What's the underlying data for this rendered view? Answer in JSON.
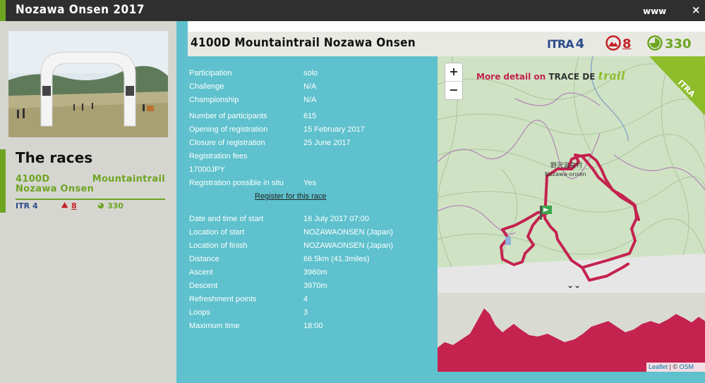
{
  "window": {
    "title": "Nozawa Onsen 2017",
    "www_label": "www",
    "close_label": "×"
  },
  "sidebar": {
    "races_title": "The races",
    "race_link": "4100D Mountaintrail Nozawa Onsen",
    "itra_value": "4",
    "mountain_value": "8",
    "points_value": "330"
  },
  "race": {
    "name": "4100D Mountaintrail Nozawa Onsen",
    "itra_label": "ITRA",
    "itra_value": "4",
    "mountain_value": "8",
    "points_value": "330"
  },
  "details_group1": [
    {
      "label": "Participation",
      "value": "solo"
    },
    {
      "label": "Challenge",
      "value": "N/A"
    },
    {
      "label": "Championship",
      "value": "N/A"
    }
  ],
  "details_group2": [
    {
      "label": "Number of participants",
      "value": "615"
    },
    {
      "label": "Opening of registration",
      "value": "15 February 2017"
    },
    {
      "label": "Closure of registration",
      "value": "25 June 2017"
    },
    {
      "label": "Registration fees",
      "value": ""
    },
    {
      "label": "17000JPY",
      "value": ""
    },
    {
      "label": "Registration possible in situ",
      "value": "Yes"
    }
  ],
  "register_link": "Register for this race",
  "details_group3": [
    {
      "label": "Date and time of start",
      "value": "16 July 2017 07:00"
    },
    {
      "label": "Location of start",
      "value": "NOZAWAONSEN (Japan)"
    },
    {
      "label": "Location of finish",
      "value": "NOZAWAONSEN (Japan)"
    },
    {
      "label": "Distance",
      "value": "66.5km (41.3miles)"
    },
    {
      "label": "Ascent",
      "value": "3960m"
    },
    {
      "label": "Descent",
      "value": "3970m"
    },
    {
      "label": "Refreshment points",
      "value": "4"
    },
    {
      "label": "Loops",
      "value": "3"
    },
    {
      "label": "Maximum time",
      "value": "18:00"
    }
  ],
  "map": {
    "zoom_in": "+",
    "zoom_out": "−",
    "more_detail": "More detail on",
    "trace_de": "TRACE DE",
    "trail": "trail",
    "place_label_jp": "野沢温泉村",
    "place_label_en": "Nozawa-onsen",
    "corner_label": "ITRA",
    "expand_label": "⌄⌄"
  },
  "attribution": {
    "leaflet": "Leaflet",
    "sep": " | © ",
    "osm": "OSM"
  },
  "colors": {
    "accent_green": "#6da521",
    "panel_teal": "#5ec1cd",
    "track_red": "#c4224f",
    "itra_blue": "#2d4c8a"
  }
}
